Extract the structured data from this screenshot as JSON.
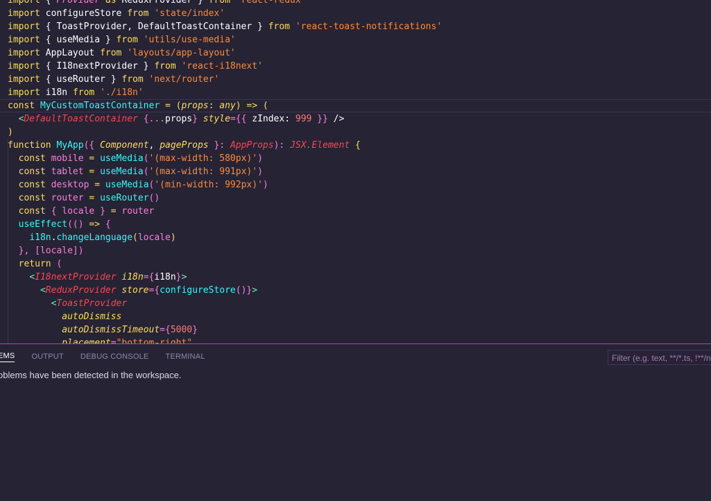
{
  "editor": {
    "lines": [
      [
        [
          "kw",
          "import"
        ],
        [
          "pl",
          " { "
        ],
        [
          "var it",
          "Provider"
        ],
        [
          "kw",
          " as "
        ],
        [
          "pl",
          "ReduxProvider } "
        ],
        [
          "kw",
          "from"
        ],
        [
          "str",
          " 'react-redux'"
        ]
      ],
      [
        [
          "kw",
          "import"
        ],
        [
          "pl",
          " configureStore "
        ],
        [
          "kw",
          "from"
        ],
        [
          "str",
          " 'state/index'"
        ]
      ],
      [
        [
          "kw",
          "import"
        ],
        [
          "pl",
          " { ToastProvider, DefaultToastContainer } "
        ],
        [
          "kw",
          "from"
        ],
        [
          "str",
          " 'react-toast-notifications'"
        ]
      ],
      [
        [
          "kw",
          "import"
        ],
        [
          "pl",
          " { useMedia } "
        ],
        [
          "kw",
          "from"
        ],
        [
          "str",
          " 'utils/use-media'"
        ]
      ],
      [
        [
          "kw",
          "import"
        ],
        [
          "pl",
          " AppLayout "
        ],
        [
          "kw",
          "from"
        ],
        [
          "str",
          " 'layouts/app-layout'"
        ]
      ],
      [
        [
          "kw",
          "import"
        ],
        [
          "pl",
          " { I18nextProvider } "
        ],
        [
          "kw",
          "from"
        ],
        [
          "str",
          " 'react-i18next'"
        ]
      ],
      [
        [
          "kw",
          "import"
        ],
        [
          "pl",
          " { useRouter } "
        ],
        [
          "kw",
          "from"
        ],
        [
          "str",
          " 'next/router'"
        ]
      ],
      [
        [
          "kw",
          "import"
        ],
        [
          "pl",
          " i18n "
        ],
        [
          "kw",
          "from"
        ],
        [
          "str",
          " './i18n'"
        ]
      ],
      [
        [
          "kw",
          "const"
        ],
        [
          "fn",
          " MyCustomToastContainer"
        ],
        [
          "kw",
          " = "
        ],
        [
          "kw",
          "("
        ],
        [
          "attr",
          "props"
        ],
        [
          "kw",
          ": "
        ],
        [
          "attr",
          "any"
        ],
        [
          "kw",
          ") => "
        ],
        [
          "kw",
          "("
        ]
      ],
      [
        [
          "pl",
          "  "
        ],
        [
          "tag",
          "<"
        ],
        [
          "typ it",
          "DefaultToastContainer"
        ],
        [
          "pl",
          " "
        ],
        [
          "var",
          "{..."
        ],
        [
          "pl",
          "props"
        ],
        [
          "var",
          "}"
        ],
        [
          "pl",
          " "
        ],
        [
          "attr",
          "style"
        ],
        [
          "var",
          "={{"
        ],
        [
          "pl",
          " zIndex: "
        ],
        [
          "num",
          "999"
        ],
        [
          "var",
          " }}"
        ],
        [
          "pl",
          " />"
        ]
      ],
      [
        [
          "kw",
          ")"
        ]
      ],
      [
        [
          "kw",
          "function"
        ],
        [
          "fn",
          " MyApp"
        ],
        [
          "var",
          "({ "
        ],
        [
          "attr",
          "Component"
        ],
        [
          "pl",
          ", "
        ],
        [
          "attr",
          "pageProps"
        ],
        [
          "var",
          " }: "
        ],
        [
          "typ it",
          "AppProps"
        ],
        [
          "var",
          "): "
        ],
        [
          "typ it",
          "JSX.Element"
        ],
        [
          "kw",
          " {"
        ]
      ],
      [
        [
          "pl",
          "  "
        ],
        [
          "kw",
          "const"
        ],
        [
          "var",
          " mobile"
        ],
        [
          "kw",
          " = "
        ],
        [
          "fn",
          "useMedia"
        ],
        [
          "var",
          "("
        ],
        [
          "str",
          "'(max-width: 580px)'"
        ],
        [
          "var",
          ")"
        ]
      ],
      [
        [
          "pl",
          "  "
        ],
        [
          "kw",
          "const"
        ],
        [
          "var",
          " tablet"
        ],
        [
          "kw",
          " = "
        ],
        [
          "fn",
          "useMedia"
        ],
        [
          "var",
          "("
        ],
        [
          "str",
          "'(max-width: 991px)'"
        ],
        [
          "var",
          ")"
        ]
      ],
      [
        [
          "pl",
          "  "
        ],
        [
          "kw",
          "const"
        ],
        [
          "var",
          " desktop"
        ],
        [
          "kw",
          " = "
        ],
        [
          "fn",
          "useMedia"
        ],
        [
          "var",
          "("
        ],
        [
          "str",
          "'(min-width: 992px)'"
        ],
        [
          "var",
          ")"
        ]
      ],
      [
        [
          "pl",
          "  "
        ],
        [
          "kw",
          "const"
        ],
        [
          "var",
          " router"
        ],
        [
          "kw",
          " = "
        ],
        [
          "fn",
          "useRouter"
        ],
        [
          "var",
          "()"
        ]
      ],
      [
        [
          "pl",
          "  "
        ],
        [
          "kw",
          "const"
        ],
        [
          "var",
          " { locale } "
        ],
        [
          "kw",
          "= "
        ],
        [
          "var",
          "router"
        ]
      ],
      [
        [
          "pl",
          "  "
        ],
        [
          "fn",
          "useEffect"
        ],
        [
          "var",
          "(() "
        ],
        [
          "kw",
          "=> "
        ],
        [
          "var",
          "{"
        ]
      ],
      [
        [
          "pl",
          "    "
        ],
        [
          "fn",
          "i18n"
        ],
        [
          "pl",
          "."
        ],
        [
          "fn",
          "changeLanguage"
        ],
        [
          "kw",
          "("
        ],
        [
          "var",
          "locale"
        ],
        [
          "kw",
          ")"
        ]
      ],
      [
        [
          "pl",
          "  "
        ],
        [
          "var",
          "}, [locale])"
        ]
      ],
      [
        [
          "pl",
          "  "
        ],
        [
          "kw",
          "return"
        ],
        [
          "var",
          " ("
        ]
      ],
      [
        [
          "pl",
          "    "
        ],
        [
          "tag",
          "<"
        ],
        [
          "typ it",
          "I18nextProvider"
        ],
        [
          "pl",
          " "
        ],
        [
          "attr",
          "i18n"
        ],
        [
          "var",
          "={"
        ],
        [
          "pl",
          "i18n"
        ],
        [
          "var",
          "}"
        ],
        [
          "tag",
          ">"
        ]
      ],
      [
        [
          "pl",
          "      "
        ],
        [
          "tag",
          "<"
        ],
        [
          "typ it",
          "ReduxProvider"
        ],
        [
          "pl",
          " "
        ],
        [
          "attr",
          "store"
        ],
        [
          "var",
          "={"
        ],
        [
          "fn",
          "configureStore"
        ],
        [
          "var",
          "()}"
        ],
        [
          "tag",
          ">"
        ]
      ],
      [
        [
          "pl",
          "        "
        ],
        [
          "tag",
          "<"
        ],
        [
          "typ it",
          "ToastProvider"
        ]
      ],
      [
        [
          "pl",
          "          "
        ],
        [
          "attr",
          "autoDismiss"
        ]
      ],
      [
        [
          "pl",
          "          "
        ],
        [
          "attr",
          "autoDismissTimeout"
        ],
        [
          "var",
          "={"
        ],
        [
          "num",
          "5000"
        ],
        [
          "var",
          "}"
        ]
      ],
      [
        [
          "pl",
          "          "
        ],
        [
          "attr",
          "placement"
        ],
        [
          "var",
          "="
        ],
        [
          "str",
          "\"bottom-right\""
        ]
      ]
    ]
  },
  "panel": {
    "tabs": [
      "EMS",
      "OUTPUT",
      "DEBUG CONSOLE",
      "TERMINAL"
    ],
    "filter_placeholder": "Filter (e.g. text, **/*.ts, !**/n",
    "message": "oblems have been detected in the workspace."
  },
  "colors": {
    "background": "#262335",
    "panel_border": "#a0509a",
    "keyword": "#fede5d",
    "function": "#36f9f6",
    "string": "#ff8b39",
    "variable": "#ff7edb",
    "type": "#fe4450"
  }
}
